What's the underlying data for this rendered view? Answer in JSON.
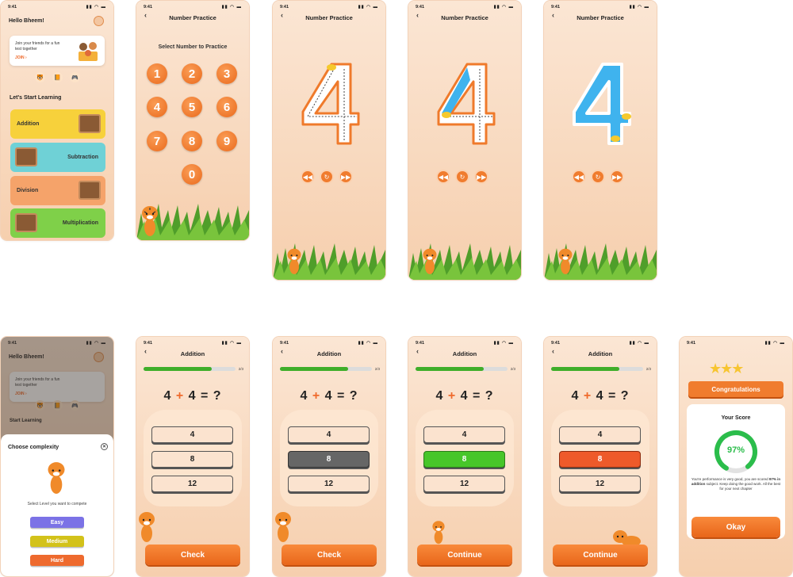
{
  "status_time": "9:41",
  "home": {
    "greeting": "Hello Bheem!",
    "card_text": "Join your friends for a fun test together",
    "join": "JOIN ›",
    "section_title": "Let's Start Learning",
    "operations": [
      {
        "label": "Addition",
        "color": "#f7d13b"
      },
      {
        "label": "Subtraction",
        "color": "#6fd1d6"
      },
      {
        "label": "Division",
        "color": "#f5a36a"
      },
      {
        "label": "Multiplication",
        "color": "#7fd049"
      }
    ]
  },
  "numpad": {
    "title": "Number Practice",
    "subtitle": "Select Number to Practice",
    "numbers": [
      "1",
      "2",
      "3",
      "4",
      "5",
      "6",
      "7",
      "8",
      "9",
      "0"
    ]
  },
  "tracing": {
    "title": "Number Practice",
    "digit": "4",
    "controls": [
      "rewind-icon",
      "replay-icon",
      "forward-icon"
    ]
  },
  "complexity": {
    "greeting": "Hello Bheem!",
    "card_text": "Join your friends for a fun test together",
    "join": "JOIN ›",
    "section_title": "Start Learning",
    "sheet_title": "Choose complexity",
    "sheet_label": "Select Level you want to compete",
    "levels": [
      {
        "label": "Easy",
        "color": "#7b72e6"
      },
      {
        "label": "Medium",
        "color": "#d3c21a"
      },
      {
        "label": "Hard",
        "color": "#ee6a2e"
      }
    ]
  },
  "quiz": {
    "title": "Addition",
    "progress_text": "2/3",
    "progress": 0.74,
    "question_a": "4",
    "question_op": "+",
    "question_b": "4",
    "question_eq": "= ?",
    "options": [
      "4",
      "8",
      "12"
    ],
    "check_label": "Check",
    "continue_label": "Continue",
    "selected_color": "#666666",
    "correct_color": "#47c629",
    "wrong_color": "#ee5a2a"
  },
  "congrats": {
    "ribbon": "Congratulations",
    "score_label": "Your Score",
    "score": "97%",
    "score_value": 0.97,
    "message_a": "You're performance is very good, you are scored ",
    "message_b": "97% in addition",
    "message_c": " subject. Keep doing the good work. All the best for your next chapter",
    "okay": "Okay"
  }
}
